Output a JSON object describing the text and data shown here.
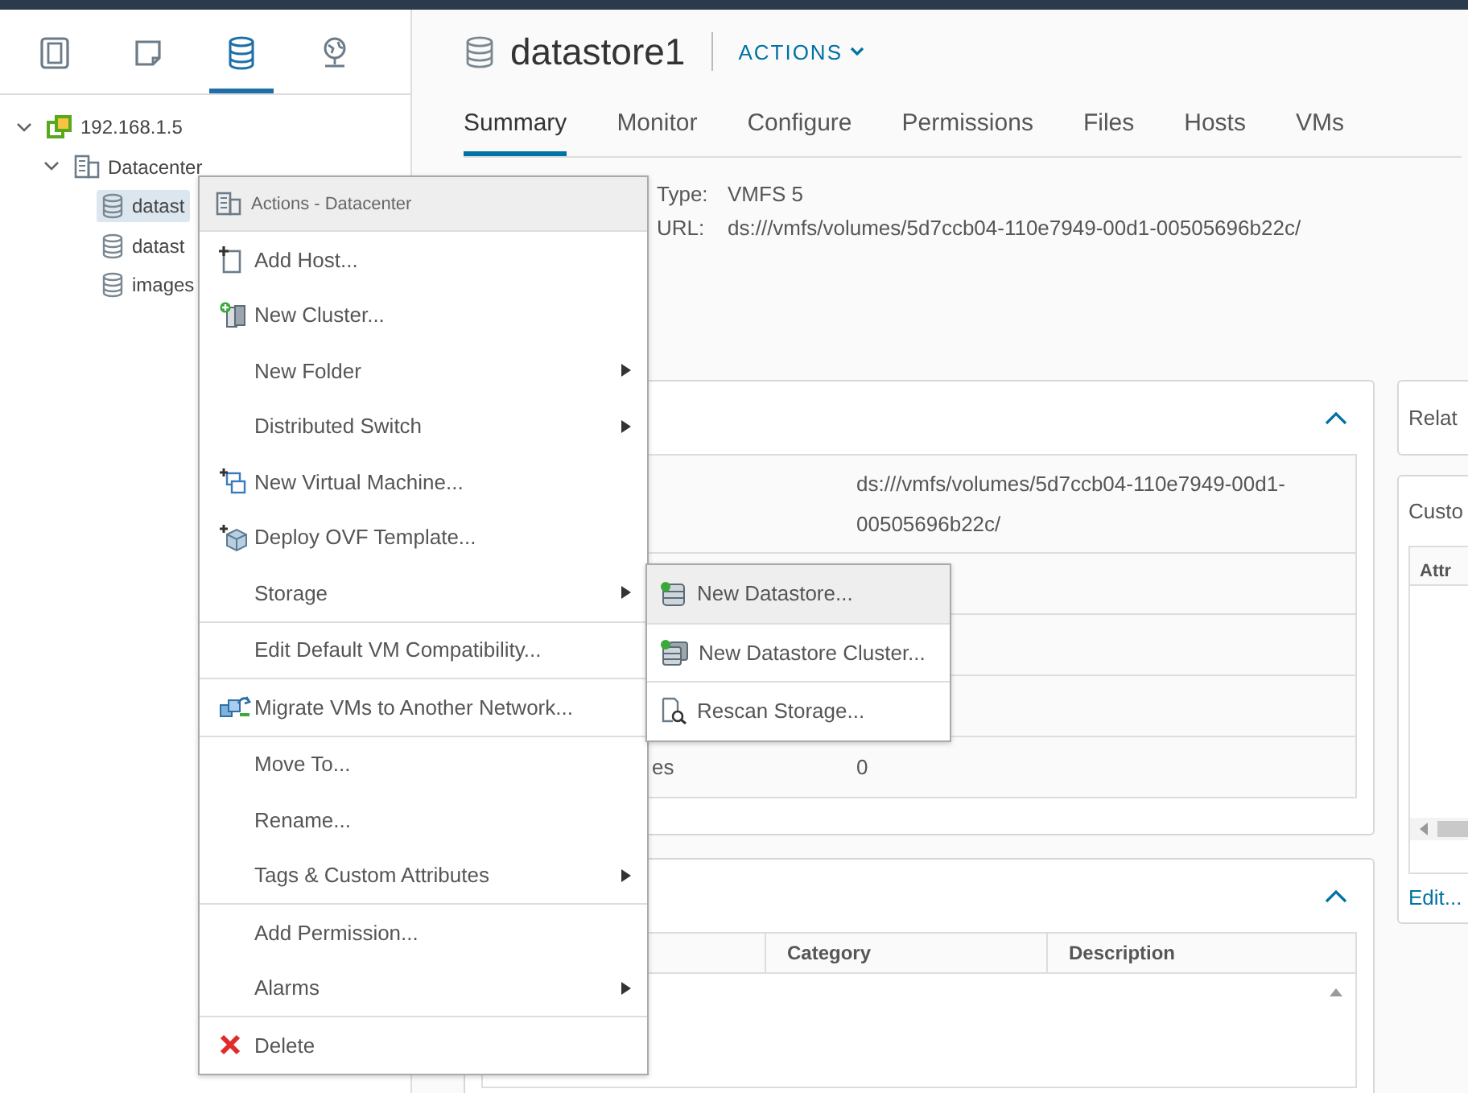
{
  "nav_tabs": [
    {
      "selected": false
    },
    {
      "selected": false
    },
    {
      "selected": true
    },
    {
      "selected": false
    }
  ],
  "tree": [
    {
      "label": "192.168.1.5",
      "expanded": true,
      "selected": false,
      "children": [
        {
          "label": "Datacenter",
          "expanded": true,
          "selected": false,
          "children": [
            {
              "label": "datast",
              "selected": true
            },
            {
              "label": "datast",
              "selected": false
            },
            {
              "label": "images",
              "selected": false
            }
          ]
        }
      ]
    }
  ],
  "object": {
    "title": "datastore1",
    "actions": "ACTIONS"
  },
  "tabs": [
    {
      "label": "Summary",
      "selected": true
    },
    {
      "label": "Monitor",
      "selected": false
    },
    {
      "label": "Configure",
      "selected": false
    },
    {
      "label": "Permissions",
      "selected": false
    },
    {
      "label": "Files",
      "selected": false
    },
    {
      "label": "Hosts",
      "selected": false
    },
    {
      "label": "VMs",
      "selected": false
    }
  ],
  "summary": [
    {
      "label": "Type:",
      "value": "VMFS 5"
    },
    {
      "label": "URL:",
      "value": "ds:///vmfs/volumes/5d7ccb04-110e7949-00d1-00505696b22c/"
    }
  ],
  "details_card": {
    "expanded": true,
    "rows": [
      {
        "value": "ds:///vmfs/volumes/5d7ccb04-110e7949-00d1-00505696b22c/"
      },
      {},
      {},
      {},
      {
        "label": "es",
        "value": "0"
      }
    ]
  },
  "tags_card": {
    "expanded": true,
    "columns": [
      "Category",
      "Description"
    ]
  },
  "related_card": {
    "title": "Relat"
  },
  "attributes_card": {
    "title": "Custo",
    "columns": [
      "Attr"
    ],
    "link": "Edit..."
  },
  "context_menu": {
    "header": "Actions - Datacenter",
    "items": [
      {
        "label": "Add Host...",
        "submenu": false,
        "separator_after": false,
        "selected": false
      },
      {
        "label": "New Cluster...",
        "submenu": false,
        "separator_after": false,
        "selected": false
      },
      {
        "label": "New Folder",
        "submenu": true,
        "separator_after": false,
        "selected": false
      },
      {
        "label": "Distributed Switch",
        "submenu": true,
        "separator_after": false,
        "selected": false
      },
      {
        "label": "New Virtual Machine...",
        "submenu": false,
        "separator_after": false,
        "selected": false
      },
      {
        "label": "Deploy OVF Template...",
        "submenu": false,
        "separator_after": false,
        "selected": false
      },
      {
        "label": "Storage",
        "submenu": true,
        "separator_after": true,
        "selected": false
      },
      {
        "label": "Edit Default VM Compatibility...",
        "submenu": false,
        "separator_after": true,
        "selected": false
      },
      {
        "label": "Migrate VMs to Another Network...",
        "submenu": false,
        "separator_after": true,
        "selected": false
      },
      {
        "label": "Move To...",
        "submenu": false,
        "separator_after": false,
        "selected": false
      },
      {
        "label": "Rename...",
        "submenu": false,
        "separator_after": false,
        "selected": false
      },
      {
        "label": "Tags & Custom Attributes",
        "submenu": true,
        "separator_after": true,
        "selected": false
      },
      {
        "label": "Add Permission...",
        "submenu": false,
        "separator_after": false,
        "selected": false
      },
      {
        "label": "Alarms",
        "submenu": true,
        "separator_after": true,
        "selected": false
      },
      {
        "label": "Delete",
        "submenu": false,
        "separator_after": false,
        "selected": false
      }
    ]
  },
  "submenu": {
    "items": [
      {
        "label": "New Datastore...",
        "selected": true
      },
      {
        "label": "New Datastore Cluster...",
        "selected": false
      },
      {
        "label": "Rescan Storage...",
        "selected": false
      }
    ]
  }
}
